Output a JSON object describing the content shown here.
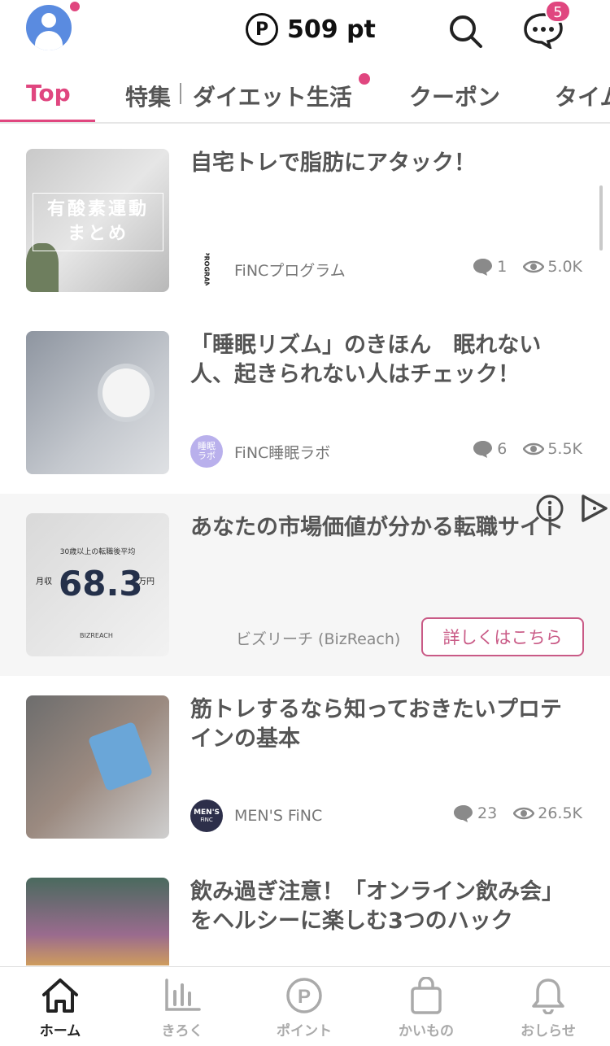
{
  "header": {
    "points_symbol": "P",
    "points_value": "509 pt",
    "message_badge": "5"
  },
  "tabs": [
    {
      "label": "Top"
    },
    {
      "label": "特集"
    },
    {
      "label": "ダイエット生活"
    },
    {
      "label": "クーポン"
    },
    {
      "label": "タイム"
    }
  ],
  "feed": [
    {
      "title": "自宅トレで脂肪にアタック！",
      "thumb_text_line1": "有酸素運動",
      "thumb_text_line2": "まとめ",
      "source": "FiNCプログラム",
      "source_logo_text": "PROGRAM",
      "comments": "1",
      "views": "5.0K"
    },
    {
      "title": "「睡眠リズム」のきほん　眠れない人、起きられない人はチェック！",
      "source": "FiNC睡眠ラボ",
      "source_logo_text": "睡眠ラボ",
      "comments": "6",
      "views": "5.5K"
    },
    {
      "title": "あなたの市場価値が分かる転職サイト",
      "thumb_caption": "30歳以上の転職後平均",
      "thumb_prefix": "月収",
      "thumb_value": "68.3",
      "thumb_suffix": "万円",
      "thumb_brand": "BIZREACH",
      "advertiser": "ビズリーチ (BizReach)",
      "cta": "詳しくはこちら"
    },
    {
      "title": "筋トレするなら知っておきたいプロテインの基本",
      "source": "MEN'S FiNC",
      "source_logo_line1": "MEN'S",
      "source_logo_line2": "FiNC",
      "comments": "23",
      "views": "26.5K"
    },
    {
      "title": "飲み過ぎ注意！「オンライン飲み会」をヘルシーに楽しむ3つのハック"
    }
  ],
  "bottom_nav": [
    {
      "label": "ホーム",
      "icon": "home-icon"
    },
    {
      "label": "きろく",
      "icon": "chart-icon"
    },
    {
      "label": "ポイント",
      "icon": "point-icon"
    },
    {
      "label": "かいもの",
      "icon": "shopping-bag-icon"
    },
    {
      "label": "おしらせ",
      "icon": "bell-icon"
    }
  ],
  "colors": {
    "accent": "#e0467f",
    "avatar_bg": "#5a8be0",
    "ad_button": "#c95a86",
    "text": "#555555"
  }
}
